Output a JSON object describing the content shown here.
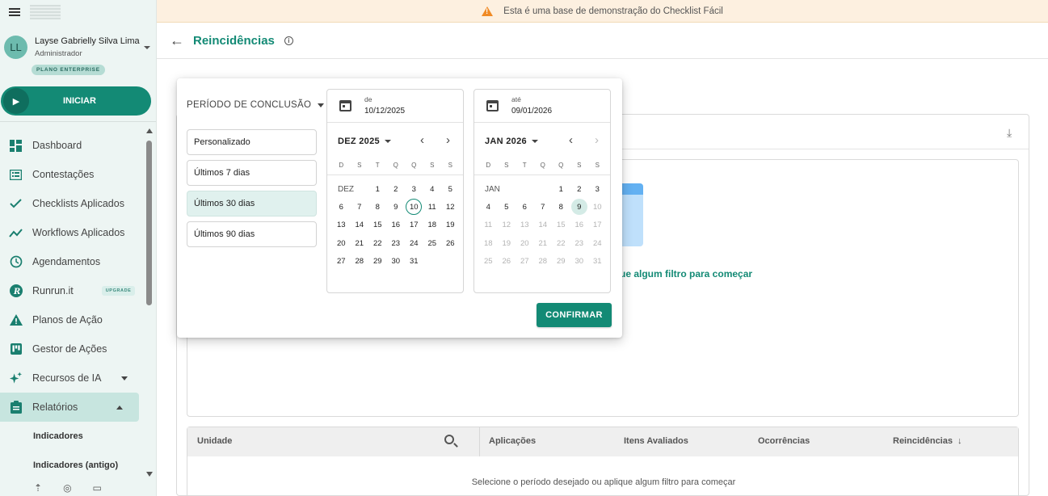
{
  "sidebar": {
    "user": {
      "initials": "LL",
      "name": "Layse Gabrielly Silva Lima",
      "role": "Administrador",
      "plan": "PLANO ENTERPRISE"
    },
    "start_label": "INICIAR",
    "items": [
      {
        "label": "Dashboard",
        "icon": "dashboard-icon"
      },
      {
        "label": "Contestações",
        "icon": "list-icon"
      },
      {
        "label": "Checklists Aplicados",
        "icon": "check-icon"
      },
      {
        "label": "Workflows Aplicados",
        "icon": "trend-icon"
      },
      {
        "label": "Agendamentos",
        "icon": "clock-icon"
      },
      {
        "label": "Runrun.it",
        "icon": "runrun-icon",
        "badge": "UPGRADE"
      },
      {
        "label": "Planos de Ação",
        "icon": "warning-icon"
      },
      {
        "label": "Gestor de Ações",
        "icon": "board-icon"
      },
      {
        "label": "Recursos de IA",
        "icon": "sparkle-icon"
      },
      {
        "label": "Relatórios",
        "icon": "clipboard-icon"
      }
    ],
    "subitems": [
      {
        "label": "Indicadores"
      },
      {
        "label": "Indicadores (antigo)"
      }
    ]
  },
  "banner": {
    "text": "Esta é uma base de demonstração do Checklist Fácil"
  },
  "header": {
    "title": "Reincidências"
  },
  "content": {
    "empty_hint": "ue algum filtro para começar",
    "table": {
      "columns": [
        "Unidade",
        "Aplicações",
        "Itens Avaliados",
        "Ocorrências",
        "Reincidências"
      ],
      "empty_text": "Selecione o período desejado ou aplique algum filtro para começar"
    }
  },
  "picker": {
    "period_label": "PERÍODO DE CONCLUSÃO",
    "presets": [
      "Personalizado",
      "Últimos 7 dias",
      "Últimos 30 dias",
      "Últimos 90 dias"
    ],
    "selected_preset": "Últimos 30 dias",
    "from": {
      "label": "de",
      "value": "10/12/2025"
    },
    "to": {
      "label": "até",
      "value": "09/01/2026"
    },
    "weekdays": [
      "D",
      "S",
      "T",
      "Q",
      "Q",
      "S",
      "S"
    ],
    "left_month": {
      "title": "DEZ 2025",
      "label": "DEZ"
    },
    "right_month": {
      "title": "JAN 2026",
      "label": "JAN"
    },
    "confirm_label": "CONFIRMAR"
  },
  "colors": {
    "accent": "#138a75",
    "banner_bg": "#fdf0e0",
    "warning": "#f08a24"
  }
}
